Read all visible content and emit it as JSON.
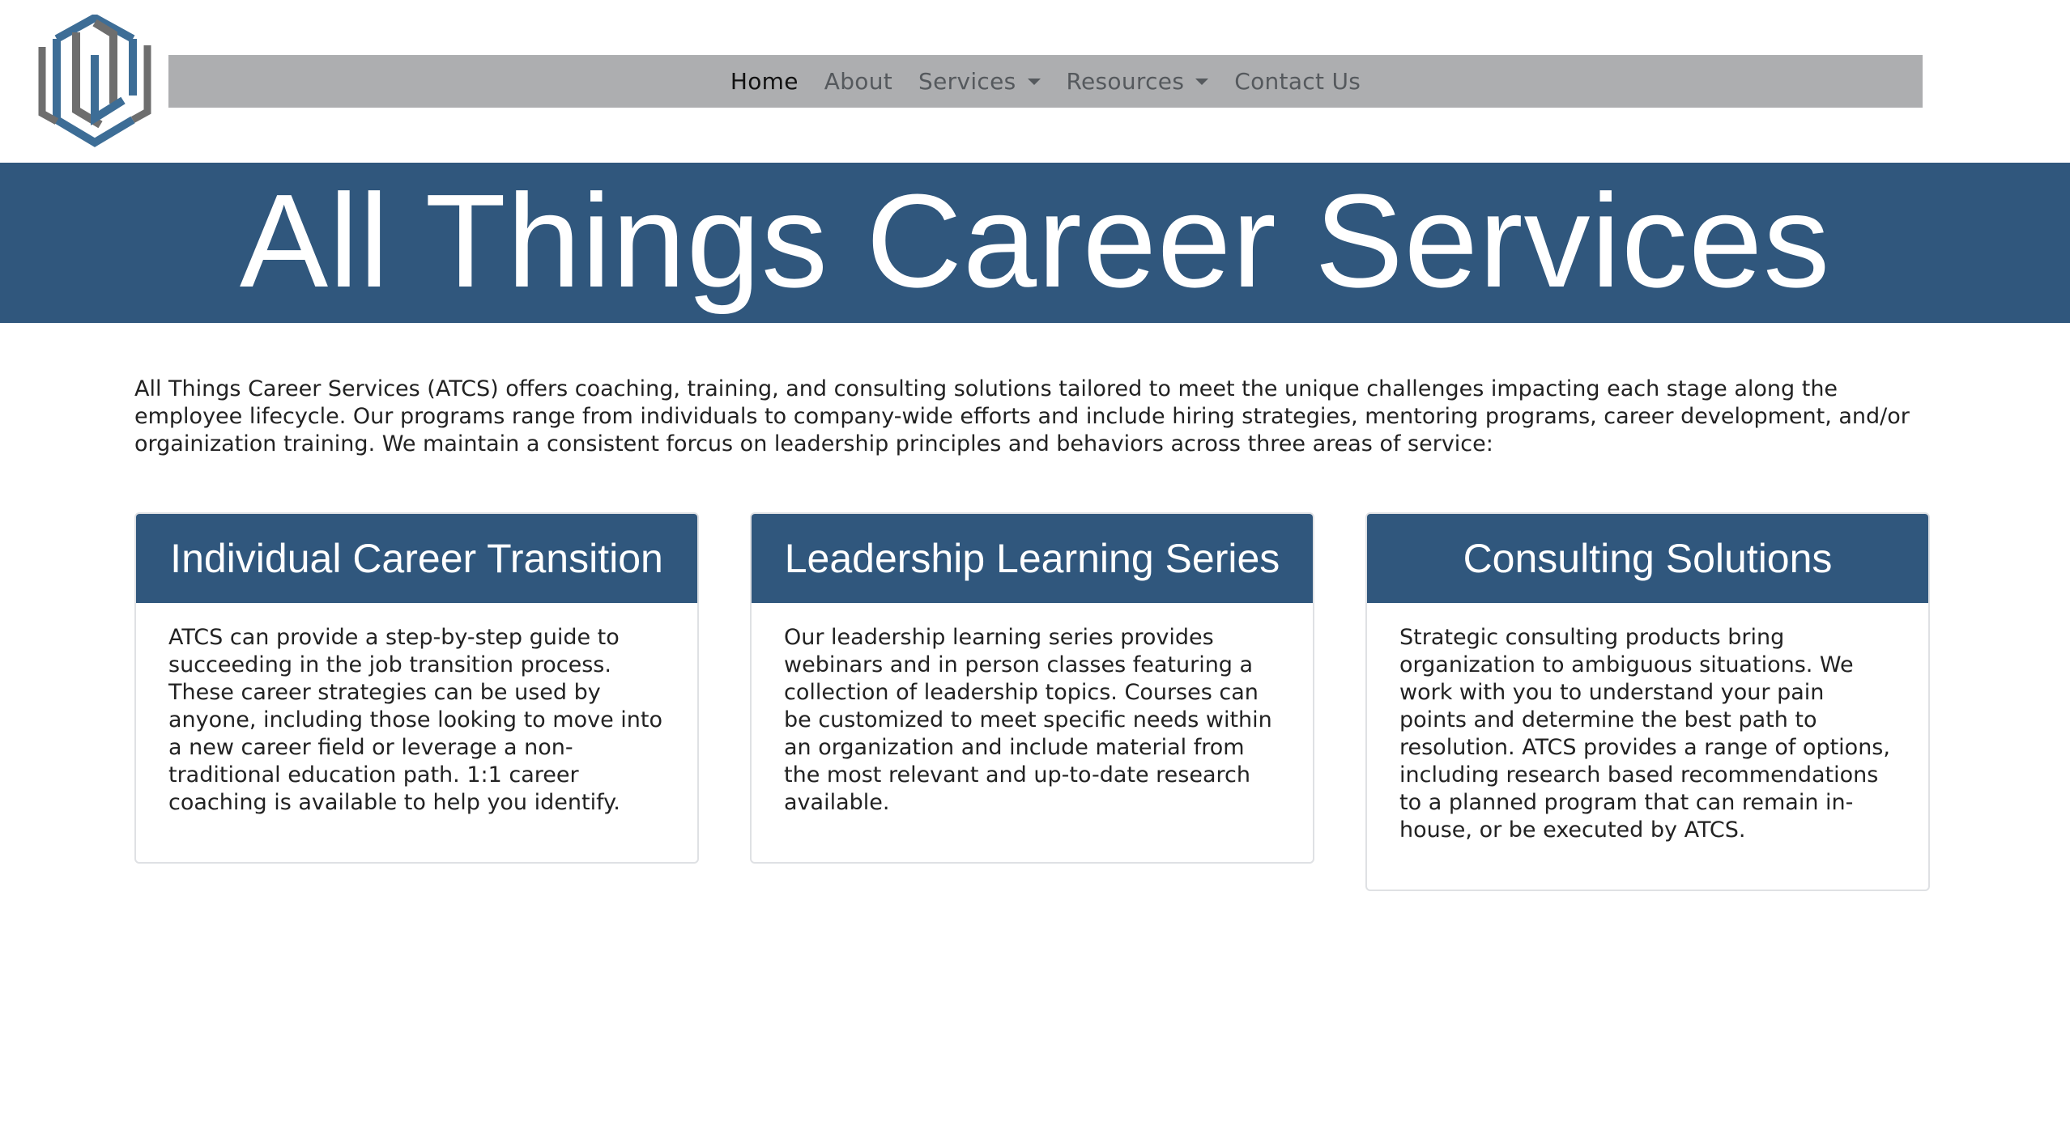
{
  "brand": {
    "logo_icon": "atcs-logo-icon"
  },
  "nav": {
    "items": [
      {
        "label": "Home",
        "active": true,
        "dropdown": false
      },
      {
        "label": "About",
        "active": false,
        "dropdown": false
      },
      {
        "label": "Services",
        "active": false,
        "dropdown": true
      },
      {
        "label": "Resources",
        "active": false,
        "dropdown": true
      },
      {
        "label": "Contact Us",
        "active": false,
        "dropdown": false
      }
    ]
  },
  "hero": {
    "title": "All Things Career Services"
  },
  "intro": {
    "text": "All Things Career Services (ATCS) offers coaching, training, and consulting solutions tailored to meet the unique challenges impacting each stage along the employee lifecycle. Our programs range from individuals to company-wide efforts and include hiring strategies, mentoring programs, career development, and/or orgainization training. We maintain a consistent forcus on leadership principles and behaviors across three areas of service:"
  },
  "cards": [
    {
      "title": "Individual Career Transition",
      "body": "ATCS can provide a step-by-step guide to succeeding in the job transition process. These career strategies can be used by anyone, including those looking to move into a new career field or leverage a non-traditional education path. 1:1 career coaching is available to help you identify."
    },
    {
      "title": "Leadership Learning Series",
      "body": "Our leadership learning series provides webinars and in person classes featuring a collection of leadership topics. Courses can be customized to meet specific needs within an organization and include material from the most relevant and up-to-date research available."
    },
    {
      "title": "Consulting Solutions",
      "body": "Strategic consulting products bring organization to ambiguous situations. We work with you to understand your pain points and determine the best path to resolution. ATCS provides a range of options, including research based recommendations to a planned program that can remain in-house, or be executed by ATCS."
    }
  ],
  "colors": {
    "brand_blue": "#30577d",
    "nav_gray": "#adaeb0",
    "logo_blue": "#3d6d96",
    "logo_gray": "#6e6e6e"
  }
}
